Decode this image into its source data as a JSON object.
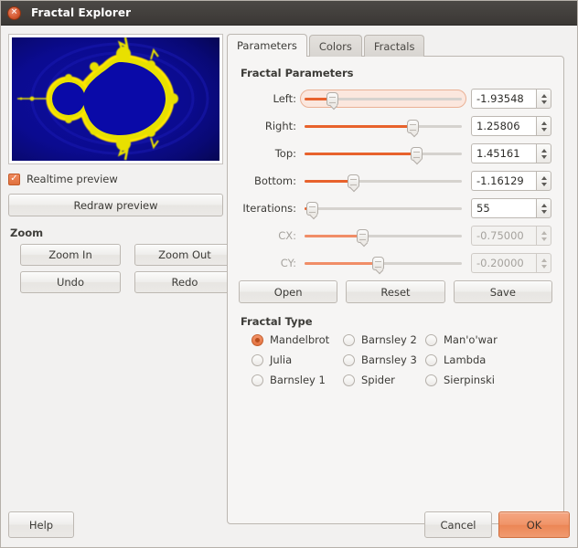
{
  "window": {
    "title": "Fractal Explorer",
    "close_icon": "window-close-icon"
  },
  "preview": {
    "name": "fractal-preview",
    "fractal": "Mandelbrot",
    "background_color": "#0a0a8c",
    "boundary_color": "#e8e000"
  },
  "left_panel": {
    "realtime_checkbox": {
      "label": "Realtime preview",
      "checked": true
    },
    "redraw_button": "Redraw preview",
    "zoom_group_title": "Zoom",
    "zoom_buttons": [
      "Zoom In",
      "Zoom Out",
      "Undo",
      "Redo"
    ]
  },
  "tabs": [
    {
      "label": "Parameters",
      "active": true
    },
    {
      "label": "Colors",
      "active": false
    },
    {
      "label": "Fractals",
      "active": false
    }
  ],
  "parameters_panel": {
    "group_title": "Fractal Parameters",
    "rows": [
      {
        "label": "Left:",
        "value": "-1.93548",
        "slider_pct": 18,
        "enabled": true,
        "focused": true
      },
      {
        "label": "Right:",
        "value": "1.25806",
        "slider_pct": 69,
        "enabled": true,
        "focused": false
      },
      {
        "label": "Top:",
        "value": "1.45161",
        "slider_pct": 71,
        "enabled": true,
        "focused": false
      },
      {
        "label": "Bottom:",
        "value": "-1.16129",
        "slider_pct": 31,
        "enabled": true,
        "focused": false
      },
      {
        "label": "Iterations:",
        "value": "55",
        "slider_pct": 5,
        "enabled": true,
        "focused": false
      },
      {
        "label": "CX:",
        "value": "-0.75000",
        "slider_pct": 37,
        "enabled": false,
        "focused": false
      },
      {
        "label": "CY:",
        "value": "-0.20000",
        "slider_pct": 47,
        "enabled": false,
        "focused": false
      }
    ],
    "file_buttons": [
      "Open",
      "Reset",
      "Save"
    ],
    "fractal_type_title": "Fractal Type",
    "fractal_types": [
      {
        "label": "Mandelbrot",
        "selected": true
      },
      {
        "label": "Barnsley 2",
        "selected": false
      },
      {
        "label": "Man'o'war",
        "selected": false
      },
      {
        "label": "Julia",
        "selected": false
      },
      {
        "label": "Barnsley 3",
        "selected": false
      },
      {
        "label": "Lambda",
        "selected": false
      },
      {
        "label": "Barnsley 1",
        "selected": false
      },
      {
        "label": "Spider",
        "selected": false
      },
      {
        "label": "Sierpinski",
        "selected": false
      }
    ]
  },
  "action_bar": {
    "help": "Help",
    "cancel": "Cancel",
    "ok": "OK",
    "ok_color": "#ef8f61"
  }
}
